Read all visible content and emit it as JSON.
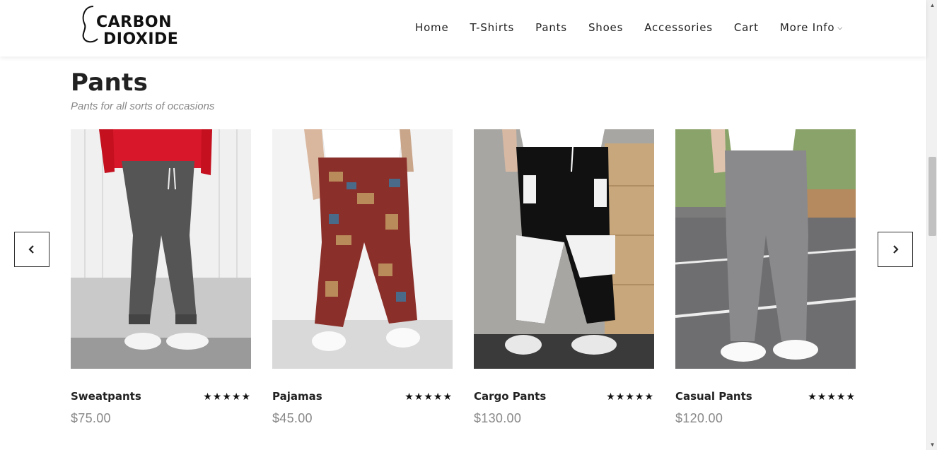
{
  "header": {
    "logo_line1": "CARBON",
    "logo_line2": "DIOXIDE",
    "nav": [
      "Home",
      "T-Shirts",
      "Pants",
      "Shoes",
      "Accessories",
      "Cart",
      "More Info"
    ]
  },
  "section": {
    "title": "Pants",
    "subtitle": "Pants for all sorts of occasions"
  },
  "stars": "★★★★★",
  "products": [
    {
      "name": "Sweatpants",
      "price": "$75.00",
      "rating": 5
    },
    {
      "name": "Pajamas",
      "price": "$45.00",
      "rating": 5
    },
    {
      "name": "Cargo Pants",
      "price": "$130.00",
      "rating": 5
    },
    {
      "name": "Casual Pants",
      "price": "$120.00",
      "rating": 5
    }
  ]
}
